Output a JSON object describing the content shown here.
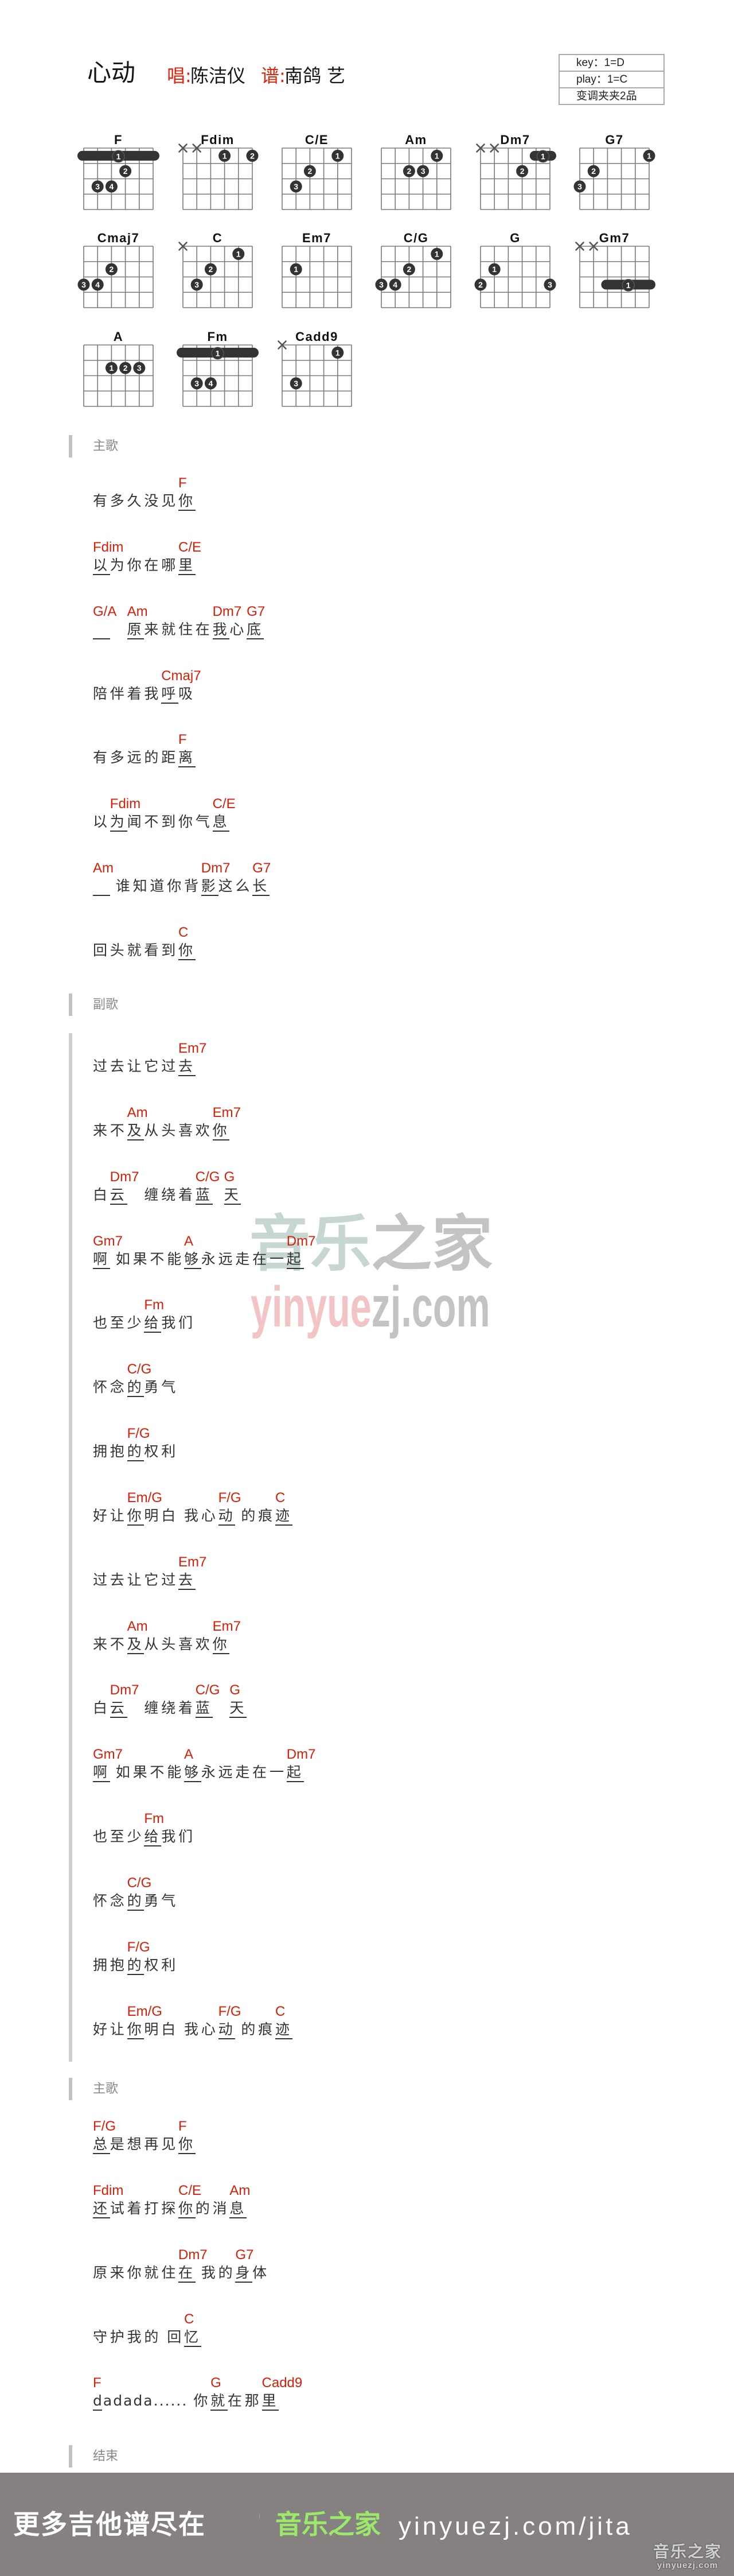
{
  "header": {
    "title": "心动",
    "singer_label": "唱:",
    "singer": "陈洁仪",
    "arranger_label": "谱:",
    "arranger": "南鸽 艺",
    "info_box": [
      "key：1=D",
      "play：1=C",
      "变调夹夹2品"
    ]
  },
  "colors": {
    "chord": "#d81e06",
    "lyric": "#333333",
    "brand_green": "#9be86a",
    "footer_bg": "#858180",
    "label_red": "#e0230a"
  },
  "chord_diagrams": [
    {
      "name": "F",
      "muted": [],
      "barres": [
        {
          "fret": 1,
          "from": 0,
          "to": 5,
          "finger": 1
        }
      ],
      "dots": [
        {
          "string": 3,
          "fret": 2,
          "finger": 2
        },
        {
          "string": 1,
          "fret": 3,
          "finger": 3
        },
        {
          "string": 2,
          "fret": 3,
          "finger": 4
        }
      ]
    },
    {
      "name": "Fdim",
      "muted": [
        0,
        1
      ],
      "barres": [],
      "dots": [
        {
          "string": 3,
          "fret": 1,
          "finger": 1
        },
        {
          "string": 5,
          "fret": 1,
          "finger": 2
        }
      ]
    },
    {
      "name": "C/E",
      "muted": [],
      "barres": [],
      "dots": [
        {
          "string": 4,
          "fret": 1,
          "finger": 1
        },
        {
          "string": 2,
          "fret": 2,
          "finger": 2
        },
        {
          "string": 1,
          "fret": 3,
          "finger": 3
        }
      ]
    },
    {
      "name": "Am",
      "muted": [],
      "barres": [],
      "dots": [
        {
          "string": 4,
          "fret": 1,
          "finger": 1
        },
        {
          "string": 2,
          "fret": 2,
          "finger": 2
        },
        {
          "string": 3,
          "fret": 2,
          "finger": 3
        }
      ]
    },
    {
      "name": "Dm7",
      "muted": [
        0,
        1
      ],
      "barres": [
        {
          "fret": 1,
          "from": 4,
          "to": 5,
          "finger": 1
        }
      ],
      "dots": [
        {
          "string": 3,
          "fret": 2,
          "finger": 2
        }
      ]
    },
    {
      "name": "G7",
      "muted": [],
      "barres": [],
      "dots": [
        {
          "string": 5,
          "fret": 1,
          "finger": 1
        },
        {
          "string": 1,
          "fret": 2,
          "finger": 2
        },
        {
          "string": 0,
          "fret": 3,
          "finger": 3
        }
      ]
    },
    {
      "name": "Cmaj7",
      "muted": [],
      "barres": [],
      "dots": [
        {
          "string": 2,
          "fret": 2,
          "finger": 2
        },
        {
          "string": 0,
          "fret": 3,
          "finger": 3
        },
        {
          "string": 1,
          "fret": 3,
          "finger": 4
        }
      ]
    },
    {
      "name": "C",
      "muted": [
        0
      ],
      "barres": [],
      "dots": [
        {
          "string": 4,
          "fret": 1,
          "finger": 1
        },
        {
          "string": 2,
          "fret": 2,
          "finger": 2
        },
        {
          "string": 1,
          "fret": 3,
          "finger": 3
        }
      ]
    },
    {
      "name": "Em7",
      "muted": [],
      "barres": [],
      "dots": [
        {
          "string": 1,
          "fret": 2,
          "finger": 1
        }
      ]
    },
    {
      "name": "C/G",
      "muted": [],
      "barres": [],
      "dots": [
        {
          "string": 4,
          "fret": 1,
          "finger": 1
        },
        {
          "string": 2,
          "fret": 2,
          "finger": 2
        },
        {
          "string": 0,
          "fret": 3,
          "finger": 3
        },
        {
          "string": 1,
          "fret": 3,
          "finger": 4
        }
      ]
    },
    {
      "name": "G",
      "muted": [],
      "barres": [],
      "dots": [
        {
          "string": 1,
          "fret": 2,
          "finger": 1
        },
        {
          "string": 0,
          "fret": 3,
          "finger": 2
        },
        {
          "string": 5,
          "fret": 3,
          "finger": 3
        }
      ]
    },
    {
      "name": "Gm7",
      "muted": [
        0,
        1
      ],
      "barres": [
        {
          "fret": 3,
          "from": 2,
          "to": 5,
          "finger": 1
        }
      ],
      "dots": []
    },
    {
      "name": "A",
      "muted": [],
      "barres": [],
      "dots": [
        {
          "string": 2,
          "fret": 2,
          "finger": 1
        },
        {
          "string": 3,
          "fret": 2,
          "finger": 2
        },
        {
          "string": 4,
          "fret": 2,
          "finger": 3
        }
      ]
    },
    {
      "name": "Fm",
      "muted": [],
      "barres": [
        {
          "fret": 1,
          "from": 0,
          "to": 5,
          "finger": 1
        }
      ],
      "dots": [
        {
          "string": 1,
          "fret": 3,
          "finger": 3
        },
        {
          "string": 2,
          "fret": 3,
          "finger": 4
        }
      ]
    },
    {
      "name": "Cadd9",
      "muted": [
        0
      ],
      "barres": [],
      "dots": [
        {
          "string": 4,
          "fret": 1,
          "finger": 1
        },
        {
          "string": 1,
          "fret": 3,
          "finger": 3
        }
      ]
    }
  ],
  "sections": [
    {
      "label": "主歌",
      "lines": [
        {
          "lyric": "有多久没见你",
          "chords": {
            "5": "F"
          }
        },
        {
          "lyric": "以为你在哪里",
          "chords": {
            "0": "Fdim",
            "5": "C/E"
          }
        },
        {
          "lyric": "　　原来就住在我心底",
          "chords": {
            "0": "G/A",
            "2": "Am",
            "7": "Dm7",
            "9": "G7"
          }
        },
        {
          "lyric": "陪伴着我呼吸",
          "chords": {
            "4": "Cmaj7"
          }
        },
        {
          "lyric": "有多远的距离",
          "chords": {
            "5": "F"
          }
        },
        {
          "lyric": "以为闻不到你气息",
          "chords": {
            "1": "Fdim",
            "7": "C/E"
          }
        },
        {
          "lyric": "　 谁知道你背影这么长",
          "chords": {
            "0": "Am",
            "7": "Dm7",
            "10": "G7"
          }
        },
        {
          "lyric": "回头就看到你",
          "chords": {
            "5": "C"
          }
        }
      ]
    },
    {
      "label": "副歌",
      "lines": [
        {
          "lyric": "过去让它过去",
          "chords": {
            "5": "Em7"
          }
        },
        {
          "lyric": "来不及从头喜欢你",
          "chords": {
            "2": "Am",
            "7": "Em7"
          }
        },
        {
          "lyric": "白云　缠绕着蓝  天",
          "chords": {
            "1": "Dm7",
            "6": "C/G",
            "9": "G"
          }
        },
        {
          "lyric": "啊 如果不能够永远走在一起",
          "chords": {
            "0": "Gm7",
            "6": "A",
            "12": "Dm7"
          }
        },
        {
          "lyric": "也至少给我们",
          "chords": {
            "3": "Fm"
          }
        },
        {
          "lyric": "怀念的勇气",
          "chords": {
            "2": "C/G"
          }
        },
        {
          "lyric": "拥抱的权利",
          "chords": {
            "2": "F/G"
          }
        },
        {
          "lyric": "好让你明白 我心动 的痕迹",
          "chords": {
            "2": "Em/G",
            "8": "F/G",
            "12": "C"
          }
        },
        {
          "lyric": "过去让它过去",
          "chords": {
            "5": "Em7"
          }
        },
        {
          "lyric": "来不及从头喜欢你",
          "chords": {
            "2": "Am",
            "7": "Em7"
          }
        },
        {
          "lyric": "白云　缠绕着蓝　天",
          "chords": {
            "1": "Dm7",
            "6": "C/G",
            "8": "G"
          }
        },
        {
          "lyric": "啊 如果不能够永远走在一起",
          "chords": {
            "0": "Gm7",
            "6": "A",
            "12": "Dm7"
          }
        },
        {
          "lyric": "也至少给我们",
          "chords": {
            "3": "Fm"
          }
        },
        {
          "lyric": "怀念的勇气",
          "chords": {
            "2": "C/G"
          }
        },
        {
          "lyric": "拥抱的权利",
          "chords": {
            "2": "F/G"
          }
        },
        {
          "lyric": "好让你明白 我心动 的痕迹",
          "chords": {
            "2": "Em/G",
            "8": "F/G",
            "12": "C"
          }
        }
      ]
    },
    {
      "label": "主歌",
      "lines": [
        {
          "lyric": "总是想再见你",
          "chords": {
            "0": "F/G",
            "5": "F"
          }
        },
        {
          "lyric": "还试着打探你的消息",
          "chords": {
            "0": "Fdim",
            "5": "C/E",
            "8": "Am"
          }
        },
        {
          "lyric": "原来你就住在 我的身体",
          "chords": {
            "5": "Dm7",
            "9": "G7"
          }
        },
        {
          "lyric": "守护我的 回忆",
          "chords": {
            "6": "C"
          }
        },
        {
          "lyric": "dadada...... 你就在那里",
          "chords": {
            "0": "F",
            "14": "G",
            "17": "Cadd9"
          }
        }
      ]
    },
    {
      "label": "结束",
      "lines": []
    }
  ],
  "watermark": {
    "brand_part1": "音乐",
    "brand_part2": "之家",
    "url_part1": "yinyue",
    "url_part2": "zj.com"
  },
  "footer": {
    "slogan": "更多吉他谱尽在",
    "brand": "音乐之家",
    "url": "yinyuezj.com/jita",
    "logo_cn": "音乐之家",
    "logo_en": "yinyuezj.com"
  }
}
